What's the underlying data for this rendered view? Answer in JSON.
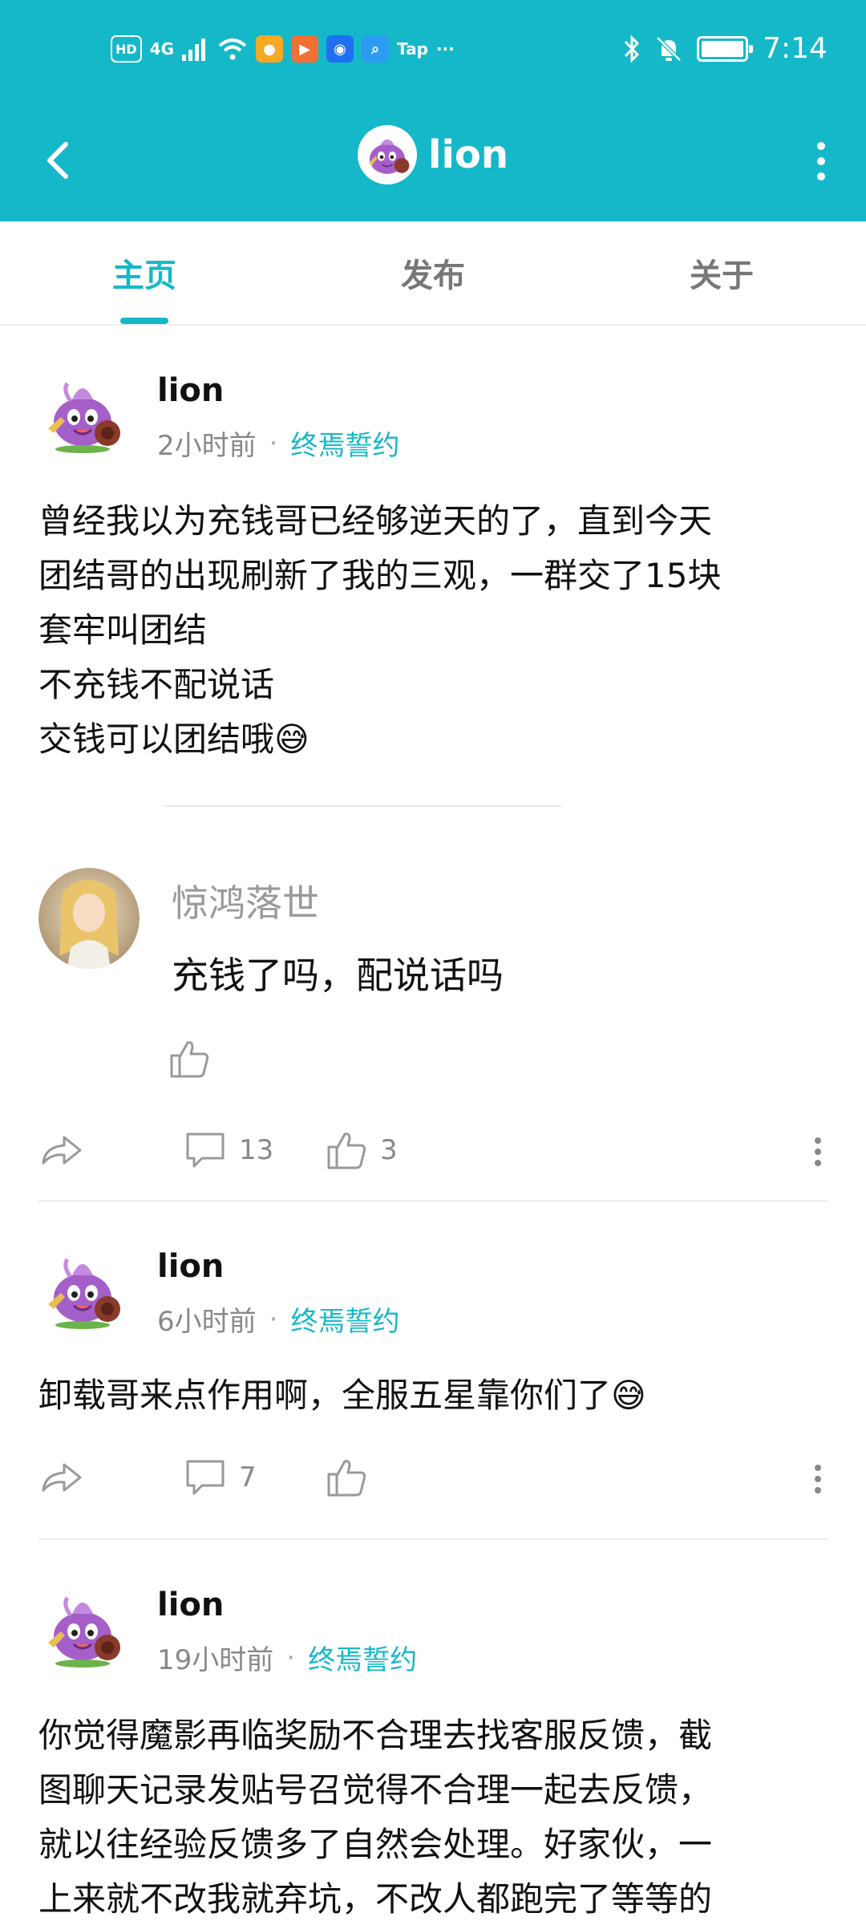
{
  "status_bar": {
    "hd": "HD",
    "net": "4G",
    "tap": "Tap",
    "dots": "···",
    "time": "7:14"
  },
  "header": {
    "title": "lion",
    "back_icon": "chevron-left-icon",
    "more_icon": "more-vertical-icon"
  },
  "tabs": [
    {
      "label": "主页",
      "active": true
    },
    {
      "label": "发布",
      "active": false
    },
    {
      "label": "关于",
      "active": false
    }
  ],
  "posts": [
    {
      "author": "lion",
      "time": "2小时前",
      "dot": "·",
      "group": "终焉誓约",
      "lines": [
        "曾经我以为充钱哥已经够逆天的了，直到今天",
        "团结哥的出现刷新了我的三观，一群交了15块",
        "套牢叫团结",
        "不充钱不配说话",
        "交钱可以团结哦😅"
      ],
      "comment": {
        "name": "惊鸿落世",
        "text": "充钱了吗，配说话吗"
      },
      "comments_count": "13",
      "likes_count": "3"
    },
    {
      "author": "lion",
      "time": "6小时前",
      "dot": "·",
      "group": "终焉誓约",
      "lines": [
        "卸载哥来点作用啊，全服五星靠你们了😅"
      ],
      "comments_count": "7",
      "likes_count": ""
    },
    {
      "author": "lion",
      "time": "19小时前",
      "dot": "·",
      "group": "终焉誓约",
      "lines": [
        "你觉得魔影再临奖励不合理去找客服反馈，截",
        "图聊天记录发贴号召觉得不合理一起去反馈，",
        "就以往经验反馈多了自然会处理。好家伙，一",
        "上来就不改我就弃坑，不改人都跑完了等等的"
      ]
    }
  ],
  "colors": {
    "accent": "#15b8c8",
    "muted": "#888888"
  }
}
